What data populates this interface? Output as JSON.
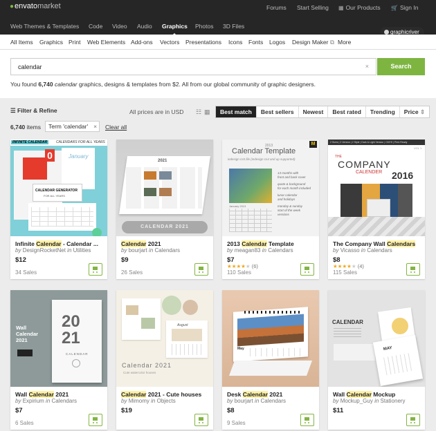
{
  "topbar": {
    "logo_main": "envato",
    "logo_sub": "market",
    "links": {
      "forums": "Forums",
      "start_selling": "Start Selling",
      "our_products": "Our Products",
      "sign_in": "Sign In"
    },
    "nav": [
      "Web Themes & Templates",
      "Code",
      "Video",
      "Audio",
      "Graphics",
      "Photos",
      "3D Files"
    ],
    "active_nav": "Graphics",
    "badge": "graphicriver"
  },
  "subnav": [
    "All Items",
    "Graphics",
    "Print",
    "Web Elements",
    "Add-ons",
    "Vectors",
    "Presentations",
    "Icons",
    "Fonts",
    "Logos",
    "Design Maker",
    "More"
  ],
  "search": {
    "value": "calendar",
    "clear": "×",
    "button": "Search",
    "found_prefix": "You found ",
    "found_count": "6,740",
    "found_term": "calendar",
    "found_suffix": " graphics, designs & templates from $2. All from our global community of graphic designers."
  },
  "filters": {
    "filter_label": "Filter & Refine",
    "prices_note": "All prices are in USD",
    "sort_options": [
      "Best match",
      "Best sellers",
      "Newest",
      "Best rated",
      "Trending",
      "Price"
    ],
    "active_sort": "Best match",
    "item_count": "6,740",
    "items_label": "items",
    "term_chip": "Term 'calendar'",
    "chip_x": "×",
    "clear_all": "Clear all"
  },
  "cards": [
    {
      "title_pre": "Infinite ",
      "title_hl": "Calendar",
      "title_post": " - Calendar ...",
      "by": "by",
      "author": "DesignRocketNet",
      "in": "in",
      "category": "Utilities",
      "price": "$12",
      "stars": "",
      "rating_count": "",
      "sales": "34 Sales"
    },
    {
      "title_pre": "",
      "title_hl": "Calendar",
      "title_post": " 2021",
      "by": "by",
      "author": "bourjart",
      "in": "in",
      "category": "Calendars",
      "price": "$9",
      "stars": "",
      "rating_count": "",
      "sales": "26 Sales"
    },
    {
      "title_pre": "2013 ",
      "title_hl": "Calendar",
      "title_post": " Template",
      "by": "by",
      "author": "meagan83",
      "in": "in",
      "category": "Calendars",
      "price": "$7",
      "stars": "★★★★",
      "stars_empty": "★",
      "rating_count": "(6)",
      "sales": "110 Sales"
    },
    {
      "title_pre": "The Company Wall ",
      "title_hl": "Calendars",
      "title_post": "",
      "by": "by",
      "author": "Vicasso",
      "in": "in",
      "category": "Calendars",
      "price": "$8",
      "stars": "★★★★",
      "stars_empty": "★",
      "rating_count": "(4)",
      "sales": "115 Sales"
    },
    {
      "title_pre": "Wall ",
      "title_hl": "Calendar",
      "title_post": " 2021",
      "by": "by",
      "author": "Expirium",
      "in": "in",
      "category": "Calendars",
      "price": "$7",
      "stars": "",
      "rating_count": "",
      "sales": "6 Sales"
    },
    {
      "title_pre": "",
      "title_hl": "Calendar",
      "title_post": " 2021 - Cute houses",
      "by": "by",
      "author": "Mimomy",
      "in": "in",
      "category": "Objects",
      "price": "$19",
      "stars": "",
      "rating_count": "",
      "sales": ""
    },
    {
      "title_pre": "Desk ",
      "title_hl": "Calendar",
      "title_post": " 2021",
      "by": "by",
      "author": "bourjart",
      "in": "in",
      "category": "Calendars",
      "price": "$8",
      "stars": "",
      "rating_count": "",
      "sales": "9 Sales"
    },
    {
      "title_pre": "Wall ",
      "title_hl": "Calendar",
      "title_post": " Mockup",
      "by": "by",
      "author": "Mockup_Guy",
      "in": "in",
      "category": "Stationery",
      "price": "$11",
      "stars": "",
      "rating_count": "",
      "sales": ""
    }
  ],
  "thumbs": {
    "t1": {
      "banner_left": "INFINITE CALENDAR",
      "banner_right": "CALENDARS FOR ALL YEARS",
      "big_num": "0",
      "title": "CALENDAR GENERATOR",
      "sub": "FOR ALL YEARS",
      "month": "January"
    },
    "t2": {
      "year": "2021",
      "label": "CALENDAR 2021"
    },
    "t3": {
      "year": "2013",
      "title": "Calendar Template",
      "sub": "indesign cs5 file (indesign cs4 and up supported)",
      "note1": "13 months with",
      "note2": "front and back cover",
      "note3": "quote & background",
      "note4": "for each month included",
      "note5": "lunar calendar",
      "note6": "and holidays",
      "note7": "monday & sunday",
      "note8": "start of the week",
      "note9": "versions",
      "month": "January 2013",
      "badge": "M"
    },
    "t4": {
      "top": "2 Sizes | 2 Version | 2 Style | Dark & Light Version | CMYK | Print Ready",
      "vol": "VOL 1",
      "company": "COMPANY",
      "the": "THE",
      "calender": "CALENDER",
      "year": "2016"
    },
    "t5": {
      "title1": "Wall",
      "title2": "Calendar",
      "title3": "2021",
      "num1": "20",
      "num2": "21",
      "label": "CALENDAR"
    },
    "t6": {
      "title": "Calendar 2021",
      "sub": "Cute watercolor houses",
      "month": "August"
    },
    "t7": {
      "month": "May"
    },
    "t8": {
      "title": "CALENDAR",
      "month": "MAY"
    }
  },
  "colors": {
    "accent": "#82b541",
    "dark": "#262626",
    "highlight": "#fff1a6"
  },
  "icons": {
    "cart": "cart-icon",
    "grid": "grid-view-icon",
    "list": "list-view-icon",
    "filter": "filter-icon",
    "leaf": "leaf-icon",
    "envelope": "external-link-icon"
  }
}
